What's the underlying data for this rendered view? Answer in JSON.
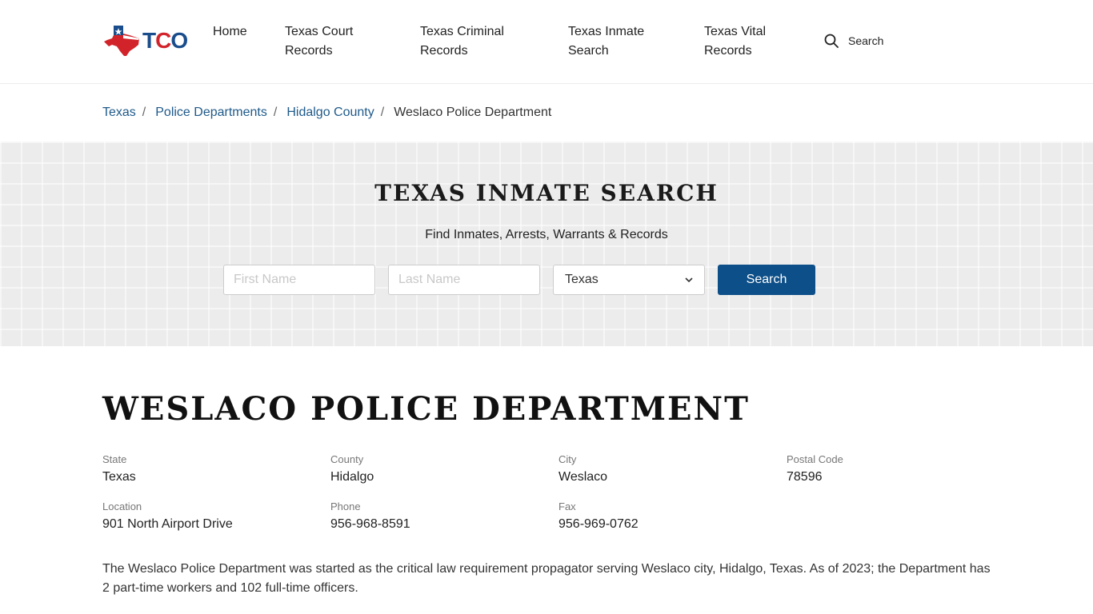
{
  "header": {
    "logo": {
      "text_t": "T",
      "text_c": "C",
      "text_o": "O"
    },
    "nav": [
      {
        "label": "Home"
      },
      {
        "label": "Texas Court Records"
      },
      {
        "label": "Texas Criminal Records"
      },
      {
        "label": "Texas Inmate Search"
      },
      {
        "label": "Texas Vital Records"
      }
    ],
    "search_label": "Search",
    "search_icon": "search-icon"
  },
  "breadcrumb": {
    "items": [
      "Texas",
      "Police Departments",
      "Hidalgo County"
    ],
    "separator": "/",
    "current": "Weslaco Police Department"
  },
  "inmate_search": {
    "title": "TEXAS INMATE SEARCH",
    "subtitle": "Find Inmates, Arrests, Warrants & Records",
    "first_name_placeholder": "First Name",
    "last_name_placeholder": "Last Name",
    "state_selected": "Texas",
    "button_label": "Search"
  },
  "department": {
    "title": "WESLACO POLICE DEPARTMENT",
    "fields": {
      "state": {
        "label": "State",
        "value": "Texas"
      },
      "county": {
        "label": "County",
        "value": "Hidalgo"
      },
      "city": {
        "label": "City",
        "value": "Weslaco"
      },
      "postal": {
        "label": "Postal Code",
        "value": "78596"
      },
      "location": {
        "label": "Location",
        "value": "901 North Airport Drive"
      },
      "phone": {
        "label": "Phone",
        "value": "956-968-8591"
      },
      "fax": {
        "label": "Fax",
        "value": "956-969-0762"
      }
    },
    "description": "The Weslaco Police Department was started as the critical law requirement propagator serving Weslaco city, Hidalgo, Texas. As of 2023; the Department has 2 part-time workers and 102 full-time officers."
  },
  "colors": {
    "link": "#1f5a8a",
    "button": "#0d4f88",
    "logo_blue": "#1a4d8c",
    "logo_red": "#d2232a"
  }
}
